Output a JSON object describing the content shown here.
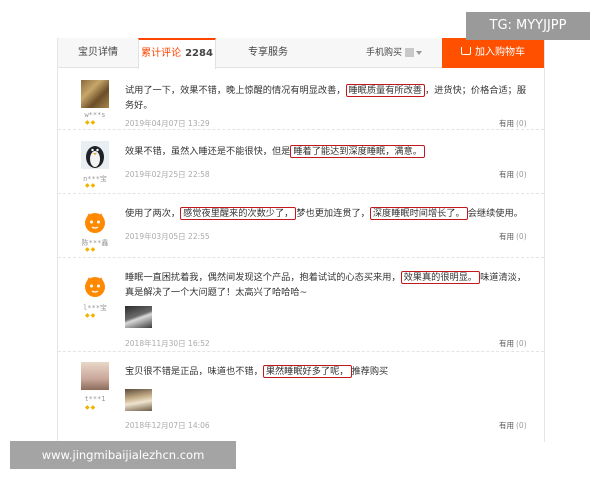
{
  "tabs": {
    "description": "宝贝详情",
    "reviews_label": "累计评论",
    "reviews_count": "2284",
    "service": "专享服务",
    "mobile_buy": "手机购买",
    "add_to_cart": "加入购物车"
  },
  "reviews": [
    {
      "nick": "w***s",
      "parts": [
        "试用了一下，效果不错，晚上惊醒的情况有明显改善，",
        "睡眠质量有所改善",
        "，进货快；价格合适；服务好。"
      ],
      "date": "2019年04月07日 13:29",
      "useful_label": "有用",
      "useful_count": "(0)"
    },
    {
      "nick": "n***宝",
      "parts": [
        "效果不错，虽然入睡还是不能很快，但是",
        "睡着了能达到深度睡眠，满意。"
      ],
      "date": "2019年02月25日 22:58",
      "useful_label": "有用",
      "useful_count": "(0)"
    },
    {
      "nick": "陈***鑫",
      "parts": [
        "使用了两次，",
        "感觉夜里醒来的次数少了，",
        "梦也更加连贯了，",
        "深度睡眠时间增长了。",
        "会继续使用。"
      ],
      "date": "2019年03月05日 22:55",
      "useful_label": "有用",
      "useful_count": "(0)"
    },
    {
      "nick": "l***宝",
      "parts": [
        "睡眠一直困扰着我，偶然间发现这个产品，抱着试试的心态买来用，",
        "效果真的很明显。",
        "味道清淡，真是解决了一个大问题了！太高兴了哈哈哈~"
      ],
      "date": "2018年11月30日 16:52",
      "useful_label": "有用",
      "useful_count": "(0)"
    },
    {
      "nick": "t***1",
      "parts": [
        "宝贝很不错是正品，味道也不错，",
        "果然睡眠好多了呢，",
        "推荐购买"
      ],
      "date": "2018年12月07日 14:06",
      "useful_label": "有用",
      "useful_count": "(0)"
    }
  ],
  "badge_glyph": "◆◆",
  "watermark_tg": "TG: MYYJJPP",
  "watermark_site": "www.jingmibaijialezhcn.com",
  "colors": {
    "accent": "#ff4400",
    "cart": "#ff5000",
    "highlight_box": "#c0181c"
  }
}
